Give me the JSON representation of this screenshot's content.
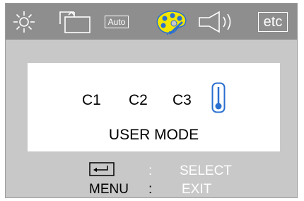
{
  "colors": {
    "toolbar_bg": "#8e8e8e",
    "osd_bg": "#c8c8c8",
    "panel_bg": "#ffffff",
    "accent": "#2a6fd0",
    "help_text": "#ffffff"
  },
  "toolbar": {
    "items": [
      {
        "icon": "brightness-icon"
      },
      {
        "icon": "image-size-icon"
      },
      {
        "icon": "auto-adjust-icon",
        "label": "Auto"
      },
      {
        "icon": "color-palette-icon",
        "selected": true
      },
      {
        "icon": "volume-icon"
      },
      {
        "icon": "etc-icon",
        "label": "etc"
      }
    ]
  },
  "main": {
    "options": [
      {
        "label": "C1"
      },
      {
        "label": "C2"
      },
      {
        "label": "C3"
      },
      {
        "icon": "thermometer-icon",
        "selected": true
      }
    ],
    "mode_title": "USER MODE"
  },
  "help": {
    "rows": [
      {
        "icon": "enter-key-icon",
        "separator": ":",
        "action": "SELECT"
      },
      {
        "key": "MENU",
        "separator": ":",
        "action": "EXIT"
      }
    ]
  }
}
